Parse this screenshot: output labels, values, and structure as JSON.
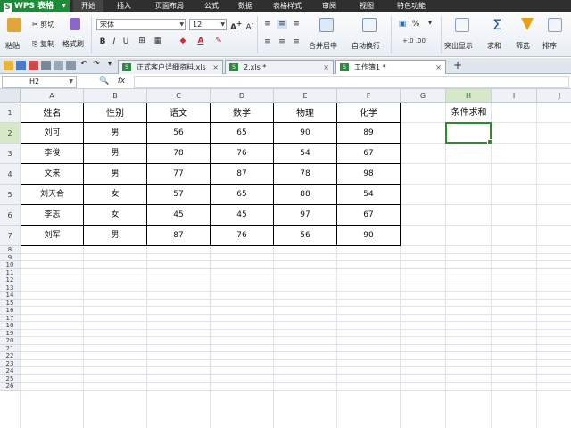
{
  "app": {
    "name": "WPS 表格",
    "logo_letter": "S"
  },
  "menu": [
    "开始",
    "插入",
    "页面布局",
    "公式",
    "数据",
    "表格样式",
    "审阅",
    "视图",
    "特色功能"
  ],
  "ribbon": {
    "paste_label": "粘贴",
    "cut_label": "剪切",
    "copy_label": "复制",
    "format_painter_label": "格式刷",
    "font_name": "宋体",
    "font_size": "12",
    "bold": "B",
    "italic": "I",
    "underline": "U",
    "merge_center_label": "合并居中",
    "wrap_text_label": "自动换行",
    "percent_label": "%",
    "conditional_display_label": "突出显示",
    "sum_label": "求和",
    "filter_label": "筛选",
    "sort_label": "排序"
  },
  "tabs": [
    {
      "label": "正式客户详细资料.xls",
      "active": false
    },
    {
      "label": "2.xls *",
      "active": false
    },
    {
      "label": "工作簿1 *",
      "active": true
    }
  ],
  "formula_bar": {
    "cell_ref": "H2",
    "fx": "fx",
    "zoom_icon": "🔍",
    "value": ""
  },
  "columns": [
    "A",
    "B",
    "C",
    "D",
    "E",
    "F",
    "G",
    "H",
    "I",
    "J"
  ],
  "rows": [
    "1",
    "2",
    "3",
    "4",
    "5",
    "6",
    "7",
    "8",
    "9",
    "10",
    "11",
    "12",
    "13",
    "14",
    "15",
    "16",
    "17",
    "18",
    "19",
    "20",
    "21",
    "22",
    "23",
    "24",
    "25",
    "26"
  ],
  "sheet": {
    "headers": [
      "姓名",
      "性别",
      "语文",
      "数学",
      "物理",
      "化学"
    ],
    "records": [
      [
        "刘可",
        "男",
        "56",
        "65",
        "90",
        "89"
      ],
      [
        "李俊",
        "男",
        "78",
        "76",
        "54",
        "67"
      ],
      [
        "文来",
        "男",
        "77",
        "87",
        "78",
        "98"
      ],
      [
        "刘天合",
        "女",
        "57",
        "65",
        "88",
        "54"
      ],
      [
        "李志",
        "女",
        "45",
        "45",
        "97",
        "67"
      ],
      [
        "刘军",
        "男",
        "87",
        "76",
        "56",
        "90"
      ]
    ],
    "extra_label": "条件求和"
  },
  "selection": {
    "column": "H",
    "row": "2"
  },
  "colors": {
    "accent_green": "#1f8a3a",
    "selection": "#2e8b2e",
    "menubar": "#2f2f2f"
  }
}
